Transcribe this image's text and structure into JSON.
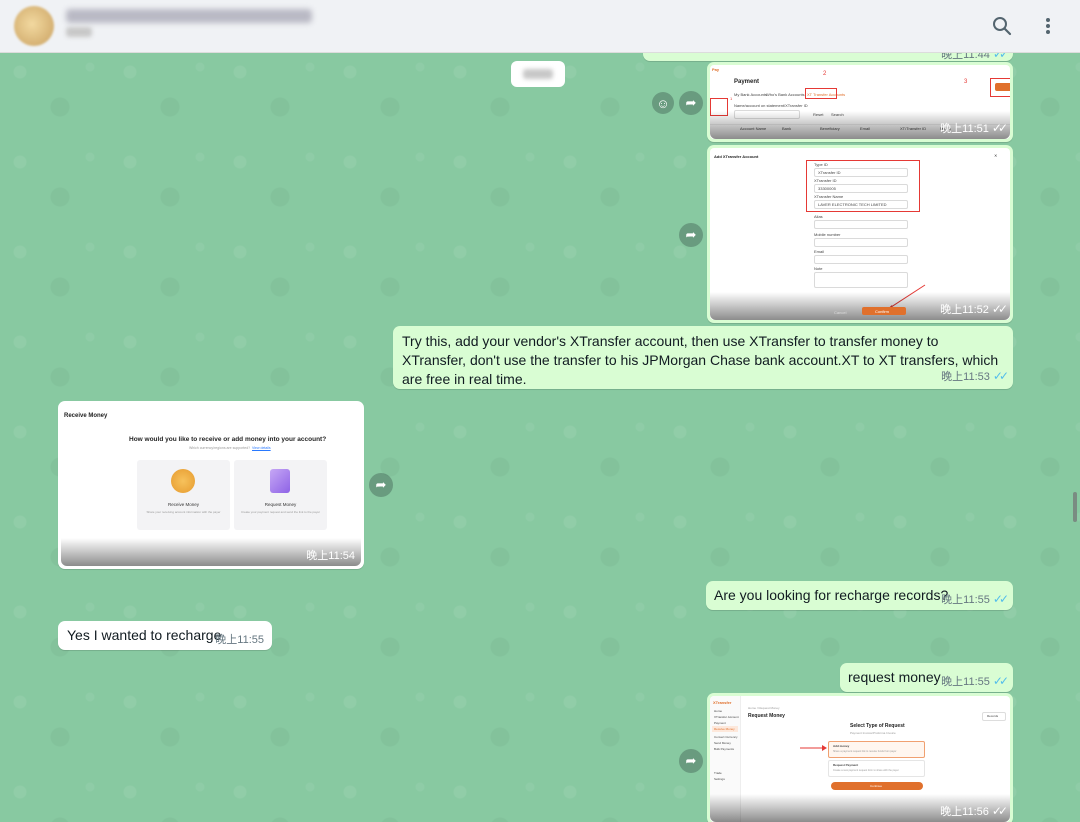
{
  "header": {
    "chat_name": "",
    "chat_sub": "",
    "icons": [
      "search-icon",
      "more-vertical-icon"
    ]
  },
  "colors": {
    "wallpaper": "#88c9a1",
    "outgoing_bubble": "#d9fdd3",
    "incoming_bubble": "#ffffff",
    "read_ticks": "#53bdeb",
    "annotation_red": "#e53935",
    "brand_orange": "#e0702c"
  },
  "messages": {
    "top_partial": {
      "time": "晚上11:44"
    },
    "img1": {
      "time": "晚上11:51",
      "title": "Payment",
      "marker2": "2",
      "marker3": "3",
      "marker1": "1",
      "tab1": "My Bank Accounts",
      "tab2": "Who's Bank Accounts",
      "tab3": "XT Transfer Accounts",
      "search_label": "Name/account on statement/XTransfer ID",
      "reset": "Reset",
      "search": "Search",
      "add_btn": "Add Account",
      "cols": [
        "Account Name",
        "Bank",
        "Beneficiary",
        "Email",
        "XT/Transfer ID",
        "Memo"
      ]
    },
    "img2": {
      "time": "晚上11:52",
      "title": "Add XTransfer Account",
      "l1": "Type ID",
      "v1": "XTransfer ID",
      "l2": "XTransfer ID",
      "v2": "33300005",
      "l3": "XTransfer Name",
      "v3": "LAVER ELECTRONIC TECH LIMITED",
      "l4": "Alias",
      "l5": "Mobile number",
      "l6": "Email",
      "l7": "Note",
      "cancel": "Cancel",
      "confirm": "Confirm"
    },
    "text1": {
      "text": "Try this, add your vendor's XTransfer account, then use XTransfer to transfer money to XTransfer, don't use the transfer to his JPMorgan Chase bank account.XT to XT transfers, which are free in real time.",
      "time": "晚上11:53"
    },
    "img3": {
      "time": "晚上11:54",
      "title": "Receive Money",
      "question": "How would you like to receive or add money into your account?",
      "sub": "Which currency/regions are supported?",
      "sub_link": "View details",
      "card1_title": "Receive Money",
      "card1_desc": "Share your receiving account information with the payer",
      "card2_title": "Request Money",
      "card2_desc": "Create your payment request and send the link to the payer"
    },
    "text2": {
      "text": "Are you looking for recharge records?",
      "time": "晚上11:55"
    },
    "text3": {
      "text": "Yes I wanted to recharge",
      "time": "晚上11:55"
    },
    "text4": {
      "text": "request money",
      "time": "晚上11:55"
    },
    "img4": {
      "time": "晚上11:56",
      "brand": "XTransfer",
      "breadcrumb": "Home / Request Money",
      "page_title": "Request Money",
      "records_btn": "Records",
      "heading": "Select Type of Request",
      "subline": "Payment Invoice/Proforma Invoice",
      "opt1_title": "Add money",
      "opt1_desc": "Share a payment request link to receive funds from payer",
      "opt2_title": "Request Payment",
      "opt2_desc": "Create a new payment request form to share with the payer",
      "continue_btn": "Continue",
      "side": [
        "Home",
        "XTransfer Account",
        "Payment",
        "Receive Money",
        "Convert Currency",
        "Send Money",
        "Bulk Payments",
        "Trade",
        "Settings"
      ]
    }
  }
}
